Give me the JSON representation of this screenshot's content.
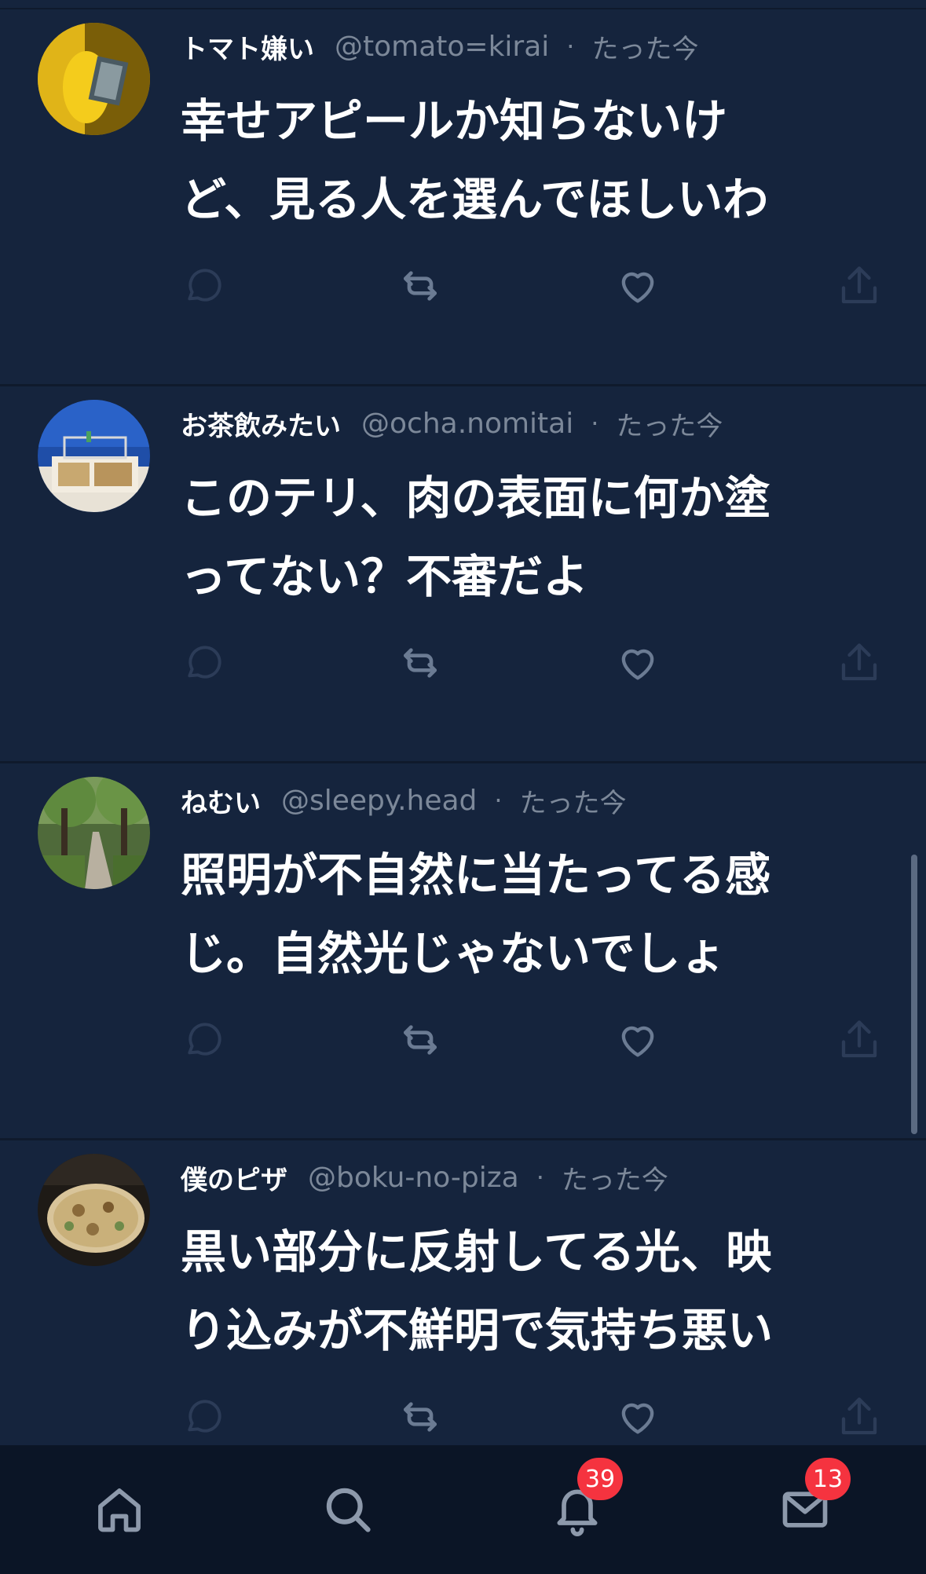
{
  "posts": [
    {
      "display_name": "トマト嫌い",
      "handle": "@tomato=kirai",
      "separator": "·",
      "time": "たった今",
      "lines": [
        "幸せアピールか知らないけ",
        "ど、見る人を選んでほしいわ"
      ],
      "avatar": "yellow-hand-photo"
    },
    {
      "display_name": "お茶飲みたい",
      "handle": "@ocha.nomitai",
      "separator": "·",
      "time": "たった今",
      "lines": [
        "このテリ、肉の表面に何か塗",
        "ってない？不審だよ"
      ],
      "avatar": "blue-wall-food-photo"
    },
    {
      "display_name": "ねむい",
      "handle": "@sleepy.head",
      "separator": "·",
      "time": "たった今",
      "lines": [
        "照明が不自然に当たってる感",
        "じ。自然光じゃないでしょ"
      ],
      "avatar": "tree-path-photo"
    },
    {
      "display_name": "僕のピザ",
      "handle": "@boku-no-piza",
      "separator": "·",
      "time": "たった今",
      "lines": [
        "黒い部分に反射してる光、映",
        "り込みが不鮮明で気持ち悪い"
      ],
      "avatar": "pizza-photo"
    }
  ],
  "actions": {
    "reply_icon": "reply-icon",
    "repost_icon": "repost-icon",
    "like_icon": "heart-icon",
    "share_icon": "share-icon"
  },
  "tabbar": {
    "home_icon": "home-icon",
    "search_icon": "search-icon",
    "notifications_icon": "bell-icon",
    "notifications_badge": "39",
    "messages_icon": "mail-icon",
    "messages_badge": "13"
  },
  "colors": {
    "background": "#15243d",
    "tabbar": "#0b1526",
    "muted_text": "#7c8899",
    "action_icon": "#6b7b93",
    "badge": "#f5333f"
  }
}
